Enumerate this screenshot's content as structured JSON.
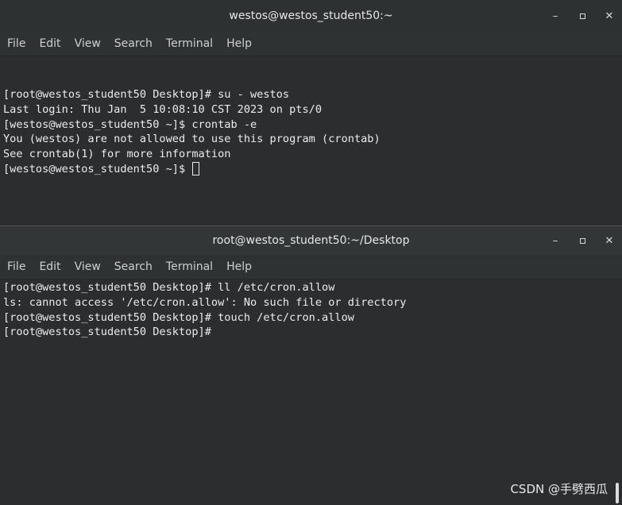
{
  "window_top": {
    "title": "westos@westos_student50:~",
    "menu": [
      "File",
      "Edit",
      "View",
      "Search",
      "Terminal",
      "Help"
    ],
    "lines": [
      "[root@westos_student50 Desktop]# su - westos",
      "Last login: Thu Jan  5 10:08:10 CST 2023 on pts/0",
      "[westos@westos_student50 ~]$ crontab -e",
      "You (westos) are not allowed to use this program (crontab)",
      "See crontab(1) for more information",
      "[westos@westos_student50 ~]$ "
    ]
  },
  "window_bottom": {
    "title": "root@westos_student50:~/Desktop",
    "menu": [
      "File",
      "Edit",
      "View",
      "Search",
      "Terminal",
      "Help"
    ],
    "lines": [
      "[root@westos_student50 Desktop]# ll /etc/cron.allow",
      "ls: cannot access '/etc/cron.allow': No such file or directory",
      "[root@westos_student50 Desktop]# touch /etc/cron.allow",
      "[root@westos_student50 Desktop]# "
    ]
  },
  "icons": {
    "minimize": "minimize-icon",
    "maximize": "maximize-icon",
    "close": "close-icon"
  },
  "watermark": "CSDN @手劈西瓜"
}
